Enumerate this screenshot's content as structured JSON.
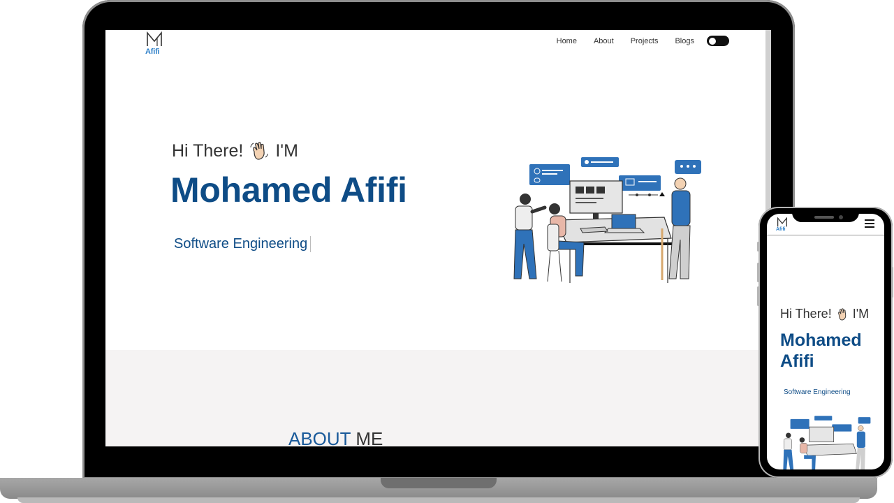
{
  "site": {
    "logo_text": "Afifi",
    "nav": [
      {
        "label": "Home"
      },
      {
        "label": "About"
      },
      {
        "label": "Projects"
      },
      {
        "label": "Blogs"
      }
    ],
    "hero": {
      "greeting_before": "Hi There!",
      "greeting_after": "I'M",
      "wave_icon": "waving-hand-emoji",
      "name": "Mohamed Afifi",
      "role": "Software Engineering"
    },
    "about": {
      "title_accent": "ABOUT",
      "title_rest": " ME"
    }
  },
  "mobile": {
    "logo_text": "Afifi",
    "menu_icon": "hamburger-menu-icon",
    "greeting_before": "Hi There!",
    "greeting_after": "I'M",
    "name": "Mohamed Afifi",
    "role": "Software Engineering"
  },
  "colors": {
    "brand_blue": "#0e4c86",
    "accent_blue": "#2c7fc8",
    "illustration_blue": "#2f72b9",
    "section_bg": "#f5f3f3"
  }
}
